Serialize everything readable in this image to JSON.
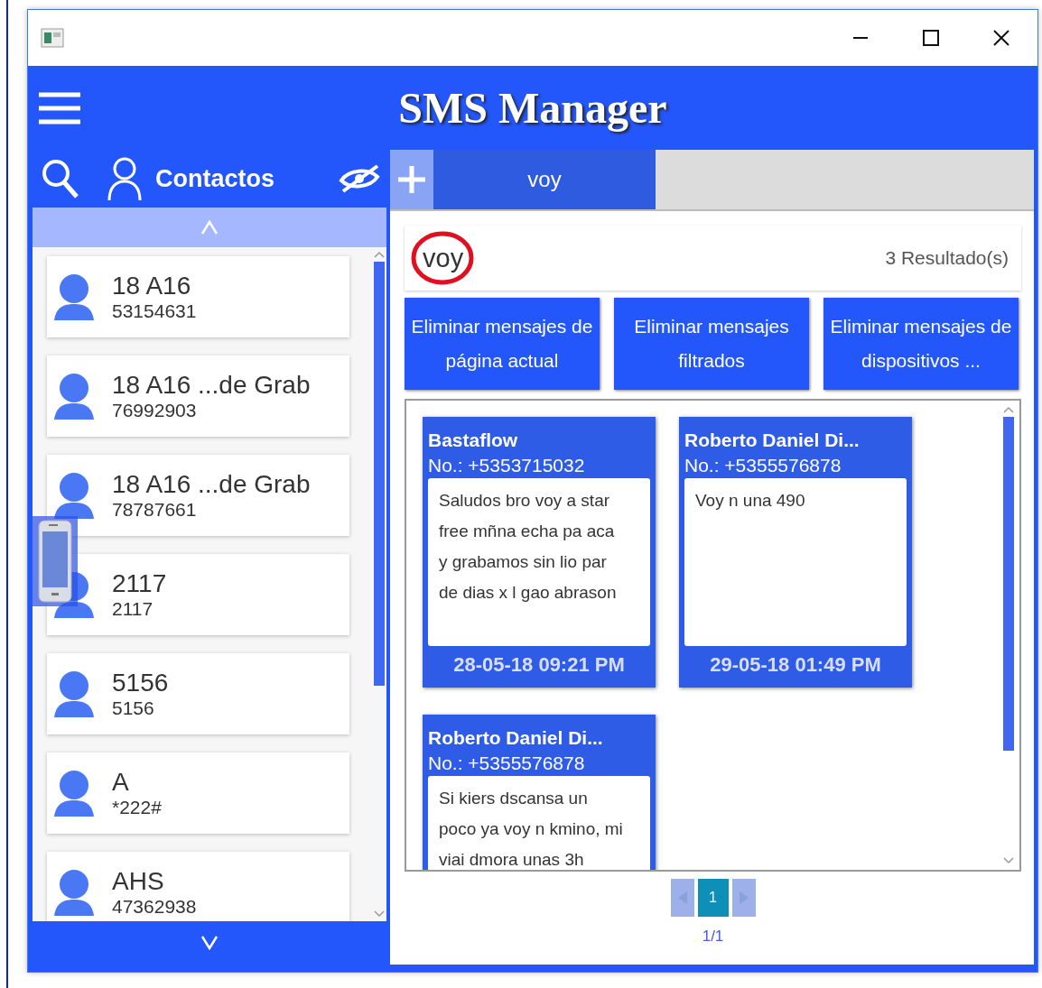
{
  "app_title": "SMS Manager",
  "sidebar": {
    "title": "Contactos",
    "contacts": [
      {
        "name": "18 A16",
        "number": "53154631"
      },
      {
        "name": "18 A16 ...de Grab",
        "number": "76992903"
      },
      {
        "name": "18 A16 ...de Grab",
        "number": "78787661"
      },
      {
        "name": "2117",
        "number": "2117"
      },
      {
        "name": "5156",
        "number": "5156"
      },
      {
        "name": "A",
        "number": "*222#"
      },
      {
        "name": "AHS",
        "number": "47362938"
      }
    ]
  },
  "tabs": [
    {
      "label": "voy",
      "selected": true
    }
  ],
  "search": {
    "value": "voy",
    "result_count": "3 Resultado(s)"
  },
  "actions": [
    "Eliminar mensajes de página actual",
    "Eliminar mensajes filtrados",
    "Eliminar mensajes de dispositivos ..."
  ],
  "messages": [
    {
      "sender": "Bastaflow",
      "number": "No.: +5353715032",
      "body": "Saludos bro voy a star free mñna echa pa aca y grabamos sin lio par de dias x l gao abrason",
      "time": "28-05-18 09:21 PM"
    },
    {
      "sender": "Roberto Daniel Di...",
      "number": "No.: +5355576878",
      "body": "Voy n una 490",
      "time": "29-05-18 01:49 PM"
    },
    {
      "sender": "Roberto Daniel Di...",
      "number": "No.: +5355576878",
      "body": "Si kiers dscansa un poco ya voy n kmino, mi viai dmora unas 3h"
    }
  ],
  "pager": {
    "pages": [
      {
        "label": "1",
        "selected": true
      }
    ],
    "status": "1/1"
  }
}
